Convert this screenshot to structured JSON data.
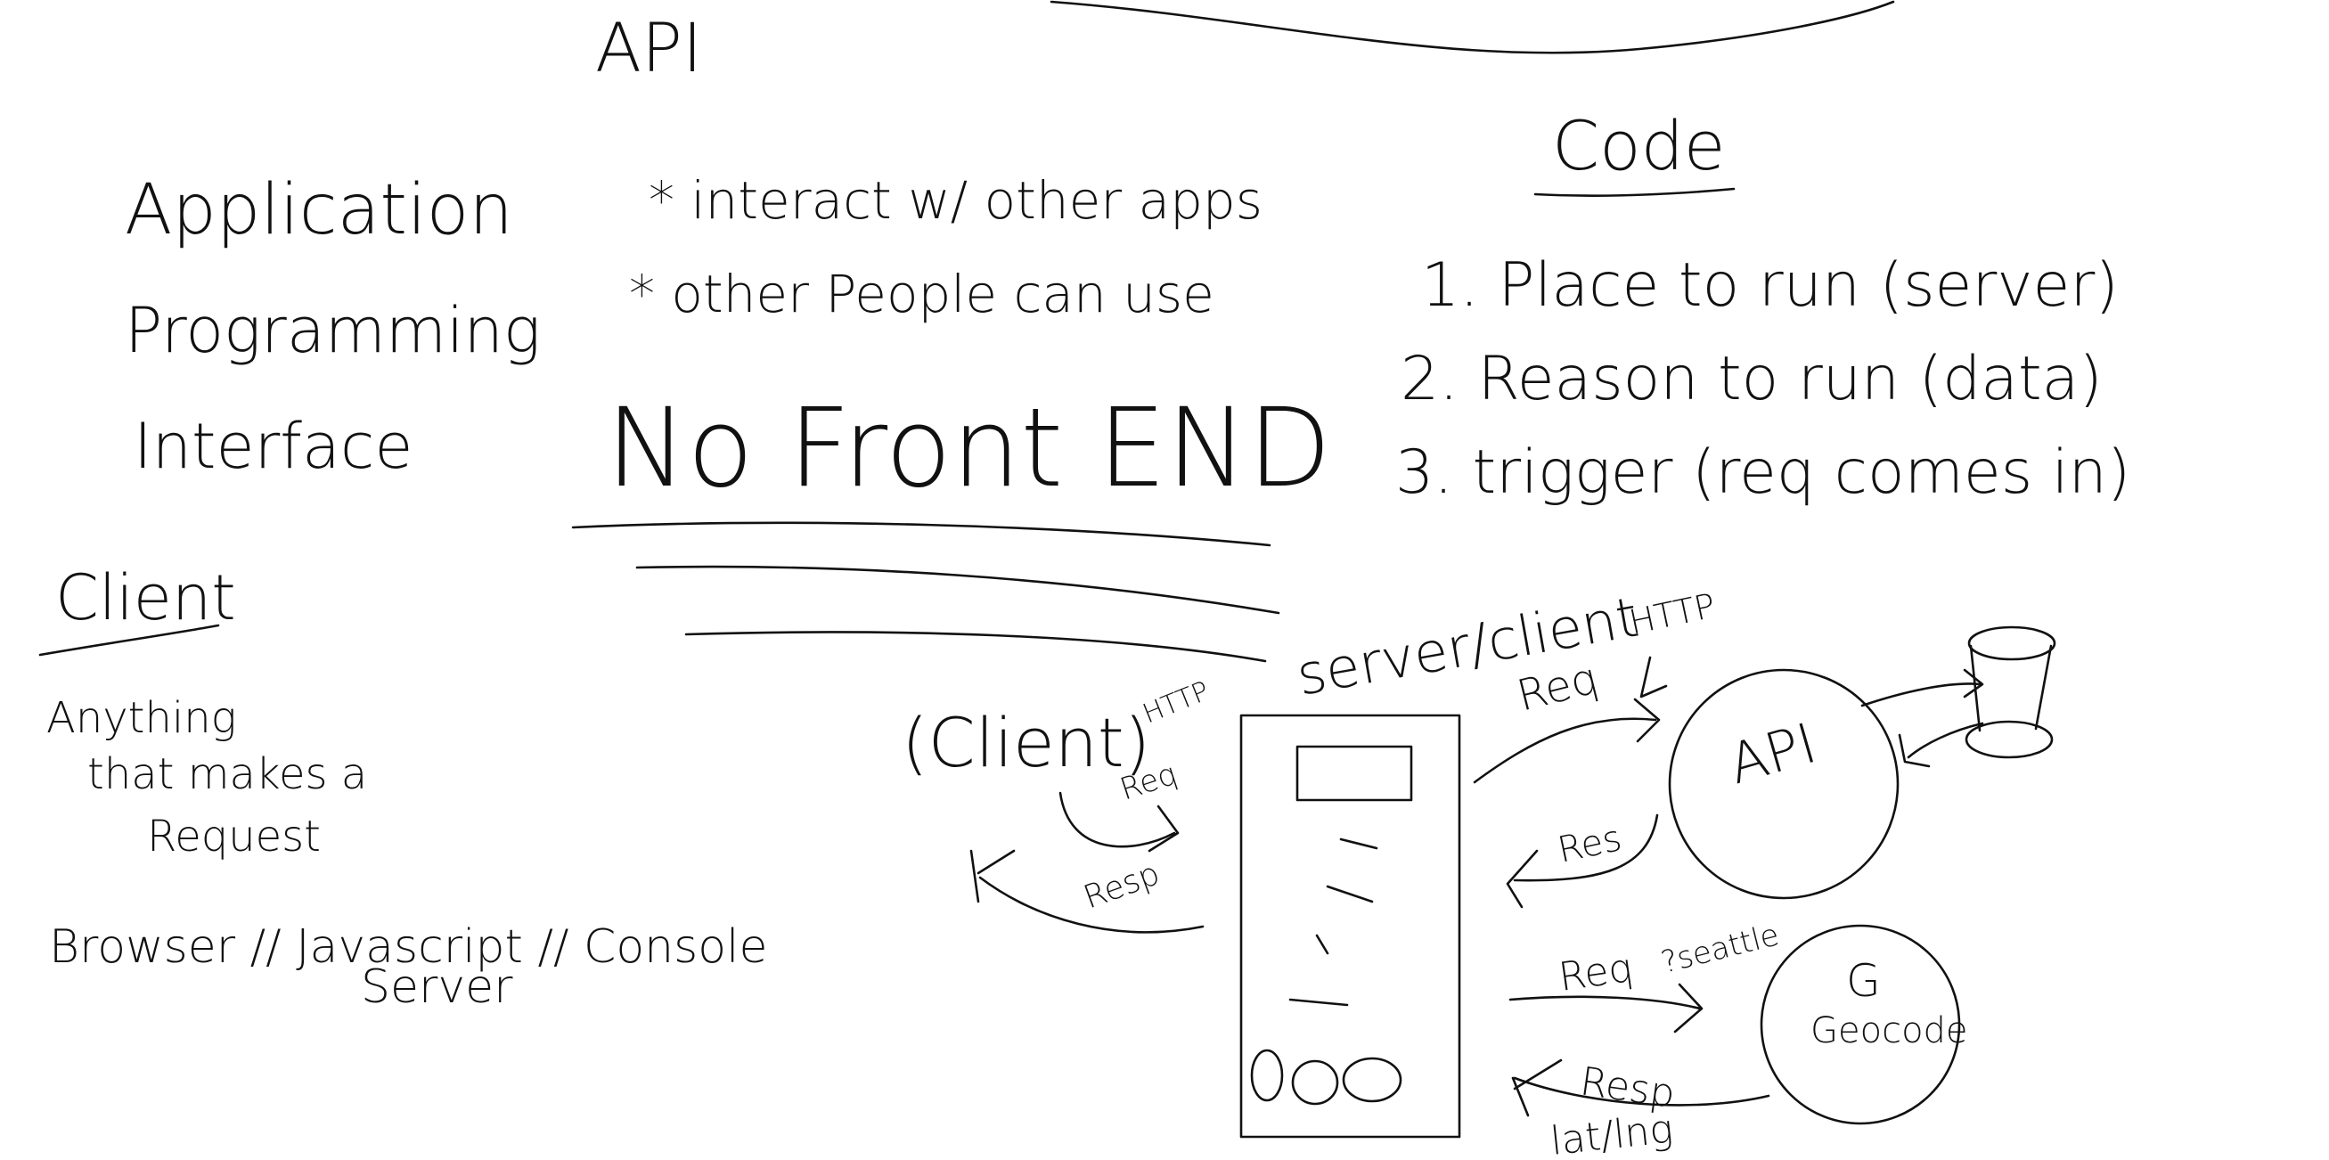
{
  "colors": {
    "background": "#ffffff",
    "ink": "#111111"
  },
  "title": "API",
  "acronym": {
    "line1": "Application",
    "line2": "Programming",
    "line3": "Interface"
  },
  "bullets": [
    "* interact w/ other apps",
    "* other People can use"
  ],
  "no_front_end": "No Front END",
  "code": {
    "heading": "Code",
    "items": [
      "1. Place to run (server)",
      "2. Reason to run (data)",
      "3. trigger (req comes in)"
    ]
  },
  "client_section": {
    "heading": "Client",
    "definition_line1": "Anything",
    "definition_line2": "that makes a",
    "definition_line3": "Request",
    "examples_line1": "Browser // Javascript // Console",
    "examples_line2": "Server"
  },
  "diagram": {
    "client_label": "(Client)",
    "client_http": "HTTP",
    "client_req": "Req",
    "client_resp": "Resp",
    "server_label": "server/client",
    "api_req": "Req",
    "api_http": "HTTP",
    "api_label": "API",
    "api_res": "Res",
    "geocode_req": "Req",
    "geocode_query": "?seattle",
    "geocode_resp": "Resp",
    "geocode_g": "G",
    "geocode_label": "Geocode",
    "latlng": "lat/lng"
  }
}
